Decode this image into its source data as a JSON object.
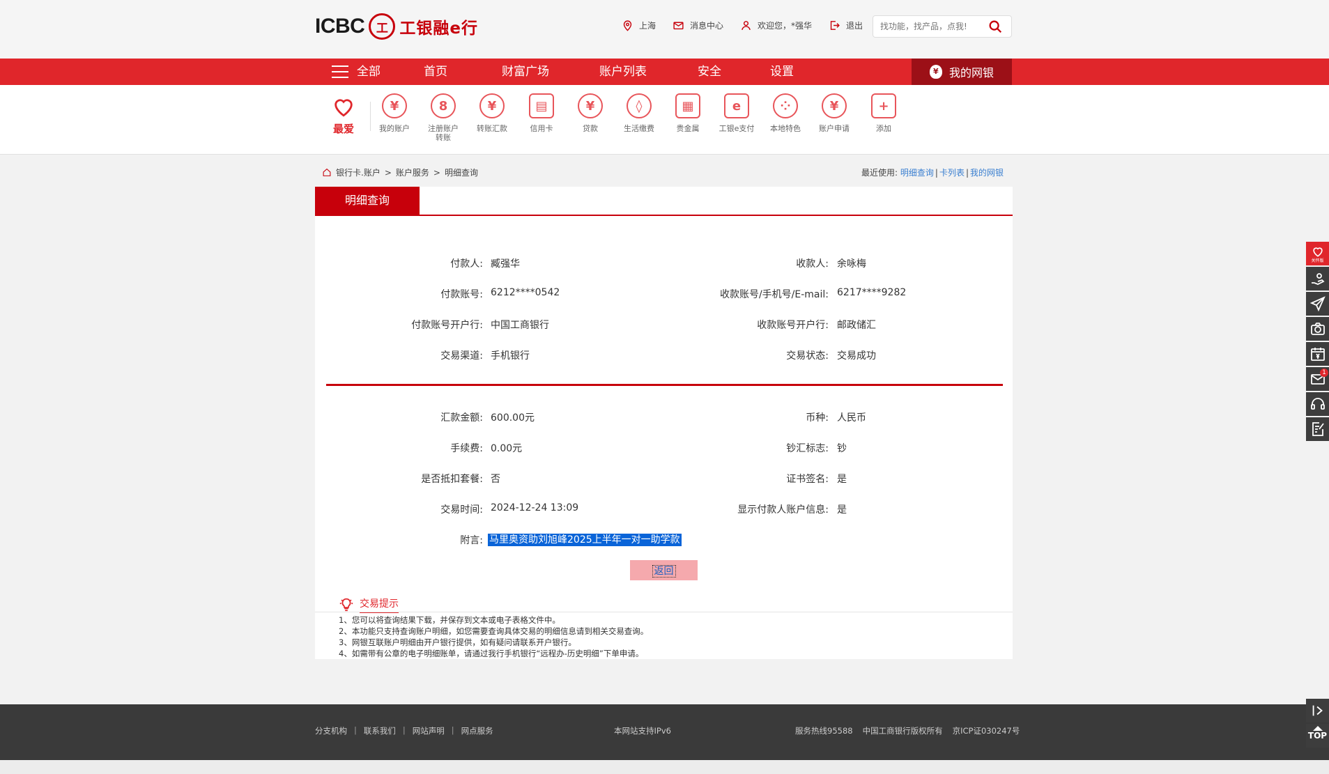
{
  "header": {
    "logo_text": "ICBC",
    "logo_seal": "工",
    "brand_name": "工银融e行",
    "location": "上海",
    "messages": "消息中心",
    "welcome": "欢迎您，*强华",
    "logout": "退出",
    "search_placeholder": "找功能，找产品，点我!"
  },
  "nav": {
    "all": "全部",
    "items": [
      "首页",
      "财富广场",
      "账户列表",
      "安全",
      "设置"
    ],
    "my_net": "我的网银"
  },
  "favorites": {
    "love_label": "最爱",
    "items": [
      {
        "label": "我的账户",
        "icon": "¥"
      },
      {
        "label": "注册账户\n转账",
        "icon": "8"
      },
      {
        "label": "转账汇款",
        "icon": "¥"
      },
      {
        "label": "信用卡",
        "icon": "▤"
      },
      {
        "label": "贷款",
        "icon": "¥"
      },
      {
        "label": "生活缴费",
        "icon": "◊"
      },
      {
        "label": "贵金属",
        "icon": "▦"
      },
      {
        "label": "工银e支付",
        "icon": "e"
      },
      {
        "label": "本地特色",
        "icon": "⁘"
      },
      {
        "label": "账户申请",
        "icon": "¥"
      },
      {
        "label": "添加",
        "icon": "+"
      }
    ]
  },
  "breadcrumb": {
    "items": [
      "银行卡.账户",
      "账户服务",
      "明细查询"
    ],
    "separator": ">"
  },
  "recent": {
    "label": "最近使用:",
    "links": [
      "明细查询",
      "卡列表",
      "我的网银"
    ]
  },
  "detail": {
    "tab": "明细查询",
    "section1": [
      {
        "left_label": "付款人:",
        "left_value": "臧强华",
        "right_label": "收款人:",
        "right_value": "余咏梅"
      },
      {
        "left_label": "付款账号:",
        "left_value": "6212****0542",
        "right_label": "收款账号/手机号/E-mail:",
        "right_value": "6217****9282"
      },
      {
        "left_label": "付款账号开户行:",
        "left_value": "中国工商银行",
        "right_label": "收款账号开户行:",
        "right_value": "邮政储汇"
      },
      {
        "left_label": "交易渠道:",
        "left_value": "手机银行",
        "right_label": "交易状态:",
        "right_value": "交易成功"
      }
    ],
    "section2": [
      {
        "left_label": "汇款金额:",
        "left_value": "600.00元",
        "right_label": "币种:",
        "right_value": "人民币"
      },
      {
        "left_label": "手续费:",
        "left_value": "0.00元",
        "right_label": "钞汇标志:",
        "right_value": "钞"
      },
      {
        "left_label": "是否抵扣套餐:",
        "left_value": "否",
        "right_label": "证书签名:",
        "right_value": "是"
      },
      {
        "left_label": "交易时间:",
        "left_value": "2024-12-24 13:09",
        "right_label": "显示付款人账户信息:",
        "right_value": "是"
      }
    ],
    "memo_label": "附言:",
    "memo_value": "马里奥资助刘旭峰2025上半年一对一助学款",
    "back_button": "返回"
  },
  "tips": {
    "title": "交易提示",
    "items": [
      "1、您可以将查询结果下载，并保存到文本或电子表格文件中。",
      "2、本功能只支持查询账户明细，如您需要查询具体交易的明细信息请到相关交易查询。",
      "3、网银互联账户明细由开户银行提供，如有疑问请联系开户银行。",
      "4、如需带有公章的电子明细账单，请通过我行手机银行“远程办-历史明细”下单申请。"
    ]
  },
  "footer": {
    "links": [
      "分支机构",
      "联系我们",
      "网站声明",
      "网点服务"
    ],
    "ipv6": "本网站支持IPv6",
    "hotline": "服务热线95588",
    "copyright": "中国工商银行版权所有",
    "icp": "京ICP证030247号"
  },
  "sidebar": {
    "care_label": "关怀版",
    "message_count": "1",
    "top_label": "TOP"
  },
  "colors": {
    "brand_red": "#e0262b",
    "dark_red": "#c7000b",
    "link_blue": "#3a7fd0",
    "selection_blue": "#0a64d8"
  }
}
